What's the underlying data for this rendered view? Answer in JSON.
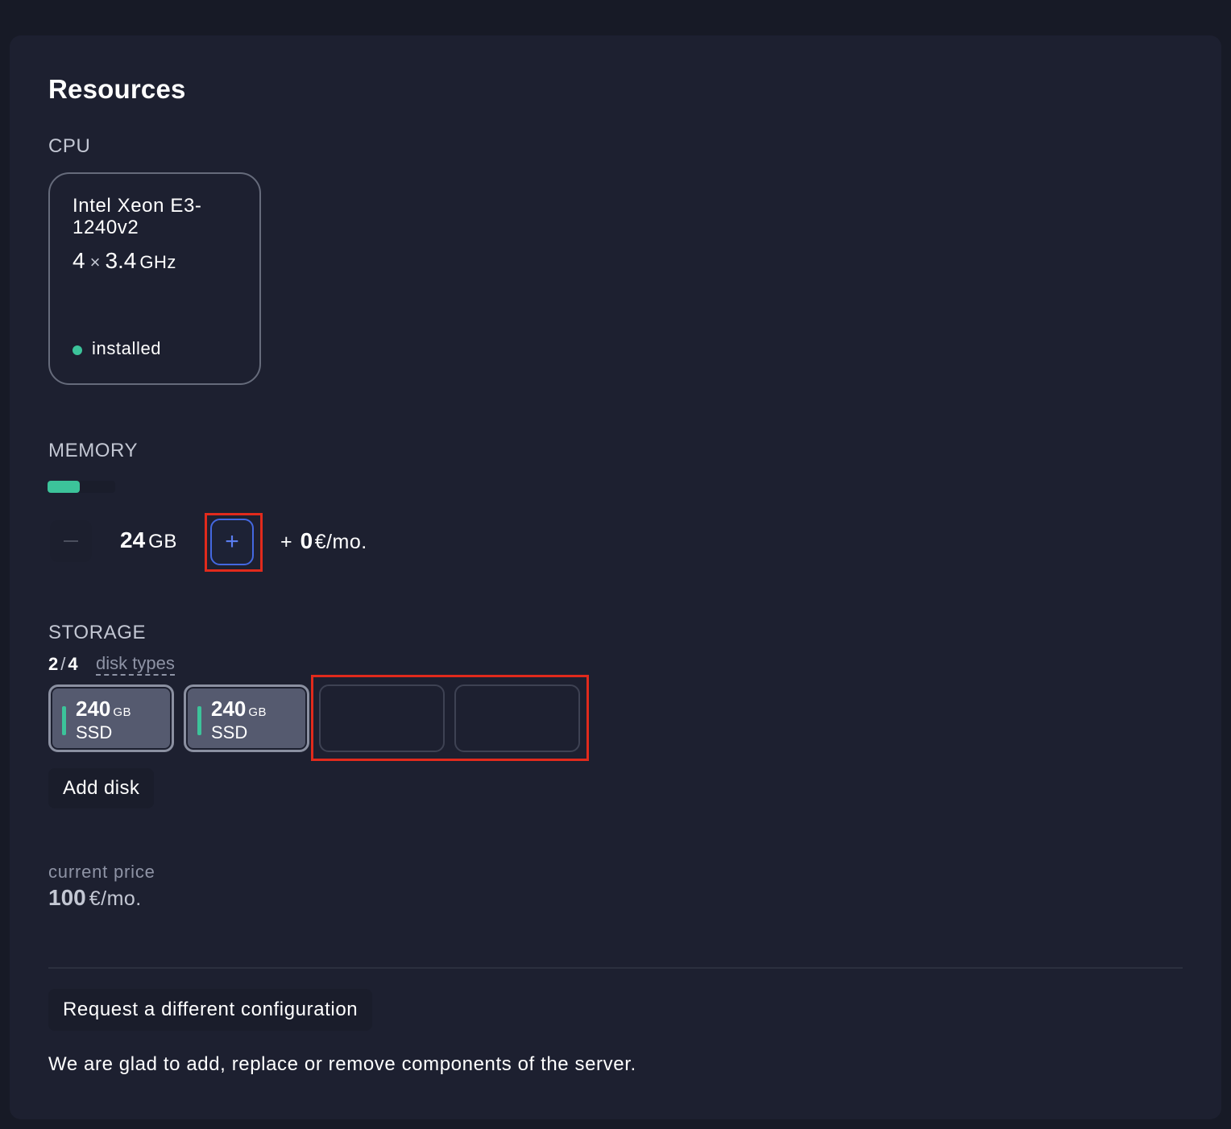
{
  "title": "Resources",
  "cpu": {
    "label": "CPU",
    "name": "Intel Xeon E3-1240v2",
    "cores": "4",
    "times": "×",
    "frequency": "3.4",
    "frequency_unit": "GHz",
    "status": "installed",
    "status_color": "#3cc39a"
  },
  "memory": {
    "label": "MEMORY",
    "usage_fraction": 0.48,
    "minus_label": "−",
    "value": "24",
    "unit": "GB",
    "plus_label": "+",
    "price_prefix": "+",
    "price_value": "0",
    "price_unit": "€/mo."
  },
  "storage": {
    "label": "STORAGE",
    "used_slots": "2",
    "separator": "/",
    "total_slots": "4",
    "disk_types_link": "disk types",
    "disks": [
      {
        "size": "240",
        "unit": "GB",
        "type": "SSD"
      },
      {
        "size": "240",
        "unit": "GB",
        "type": "SSD"
      }
    ],
    "add_disk_label": "Add disk"
  },
  "price": {
    "label": "current price",
    "value": "100",
    "unit": "€/mo."
  },
  "request_button": "Request a different configuration",
  "note": "We are glad to add, replace or remove components of the server.",
  "colors": {
    "accent_green": "#3cc39a",
    "accent_blue": "#4468e0",
    "highlight_red": "#e12a1c",
    "background": "#1d2030"
  }
}
